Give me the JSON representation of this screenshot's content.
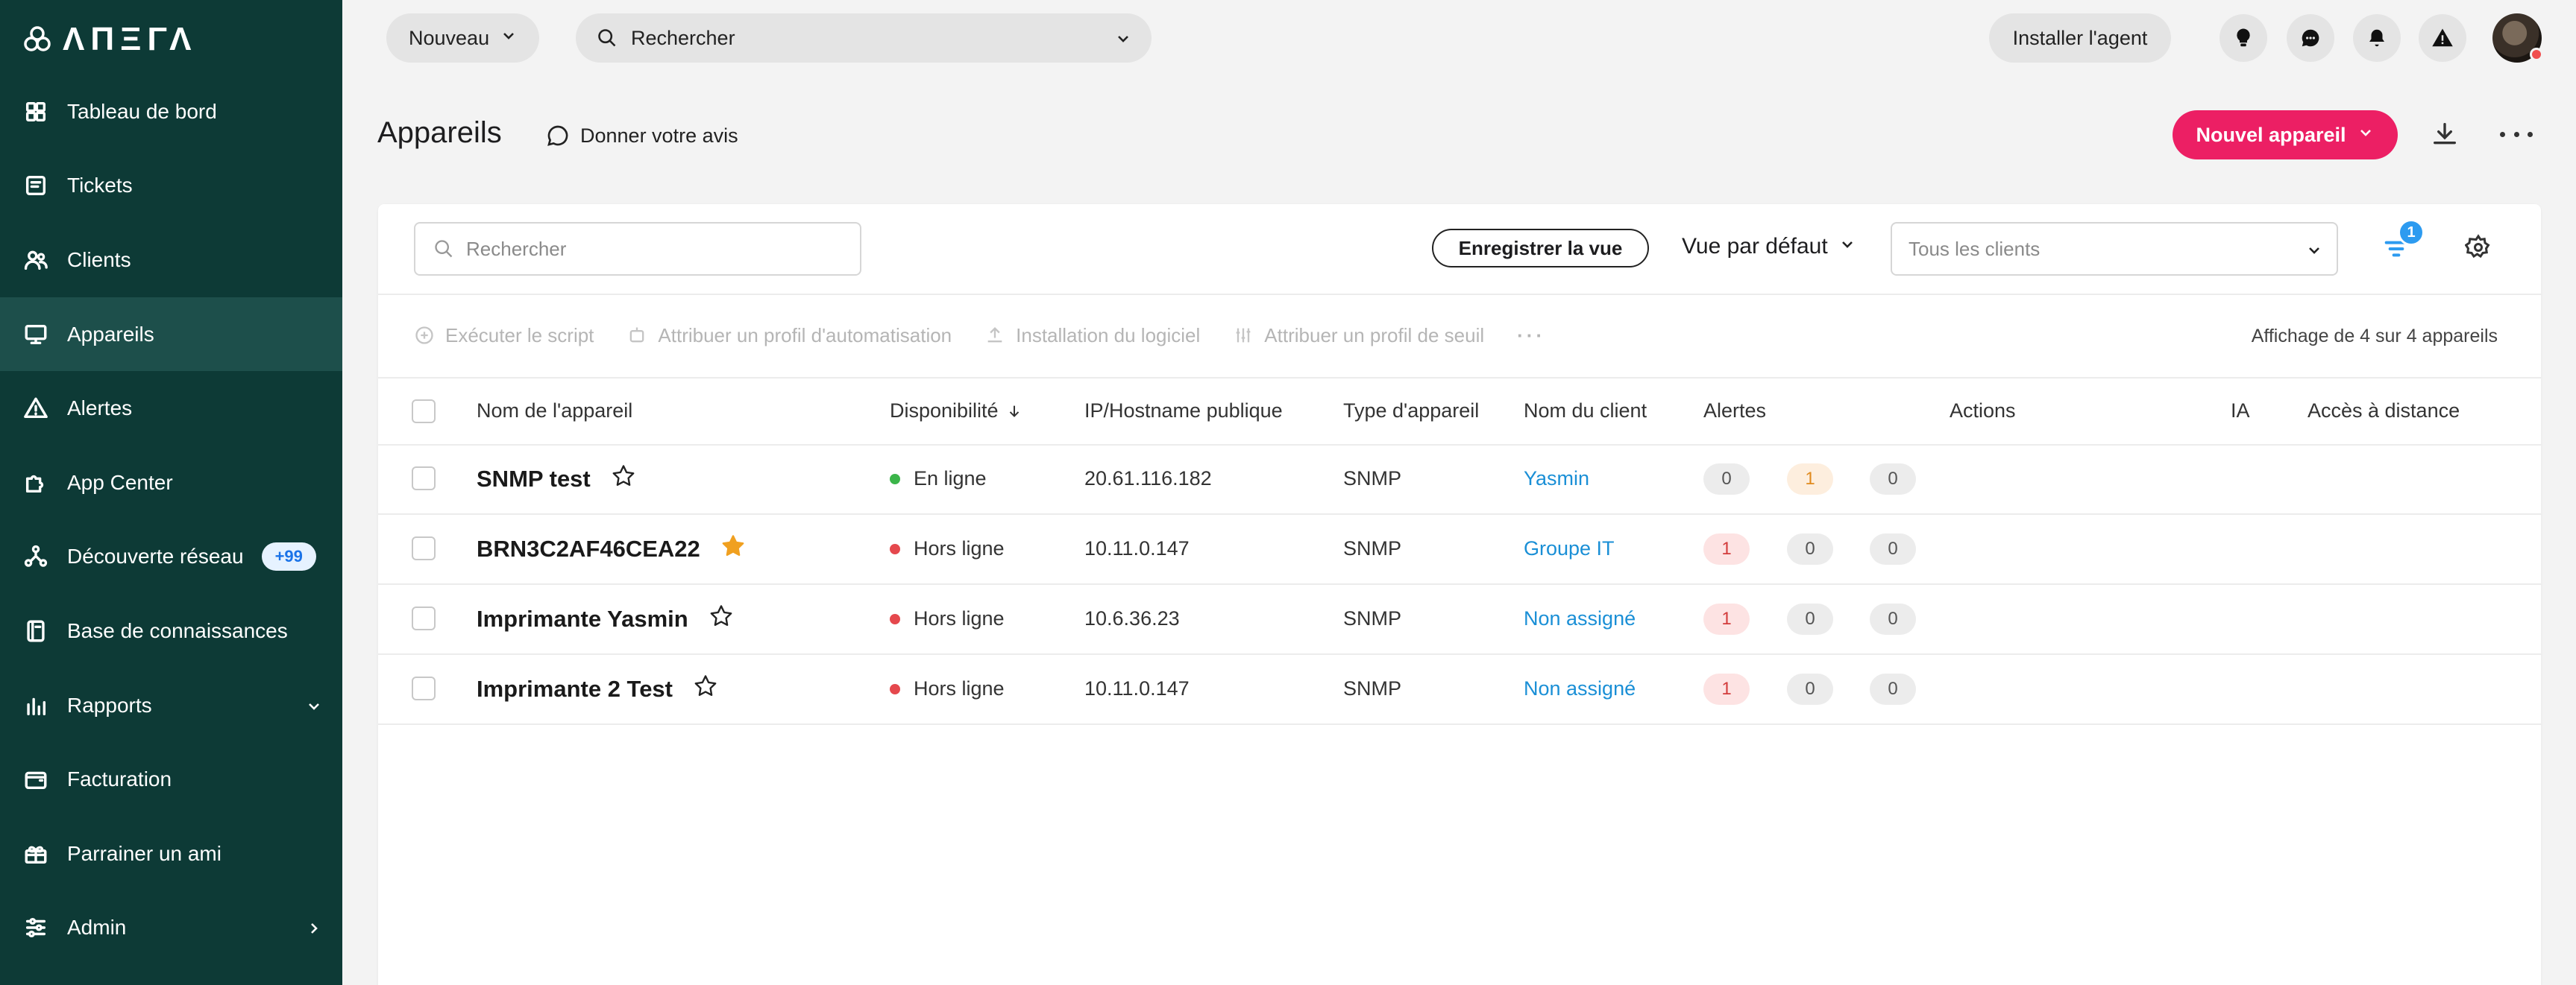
{
  "app": {
    "logo_text": "ΛΠΞΓΛ"
  },
  "sidebar": {
    "items": [
      {
        "label": "Tableau de bord",
        "icon": "dashboard-icon"
      },
      {
        "label": "Tickets",
        "icon": "ticket-icon"
      },
      {
        "label": "Clients",
        "icon": "users-icon"
      },
      {
        "label": "Appareils",
        "icon": "monitor-icon",
        "active": true
      },
      {
        "label": "Alertes",
        "icon": "warning-icon"
      },
      {
        "label": "App Center",
        "icon": "puzzle-icon"
      },
      {
        "label": "Découverte réseau",
        "icon": "network-icon",
        "badge": "+99"
      },
      {
        "label": "Base de connaissances",
        "icon": "book-icon"
      },
      {
        "label": "Rapports",
        "icon": "chart-icon",
        "arrow": "chevron-down-icon"
      },
      {
        "label": "Facturation",
        "icon": "wallet-icon"
      },
      {
        "label": "Parrainer un ami",
        "icon": "gift-icon"
      },
      {
        "label": "Admin",
        "icon": "sliders-icon",
        "arrow": "chevron-right-icon"
      }
    ]
  },
  "topbar": {
    "new_label": "Nouveau",
    "search_label": "Rechercher",
    "install_agent_label": "Installer l'agent"
  },
  "header": {
    "title": "Appareils",
    "feedback_label": "Donner votre avis",
    "new_device_label": "Nouvel appareil"
  },
  "filters": {
    "search_placeholder": "Rechercher",
    "save_view_label": "Enregistrer la vue",
    "view_label": "Vue par défaut",
    "clients_placeholder": "Tous les clients",
    "filter_count": "1"
  },
  "toolbar": {
    "run_script": "Exécuter le script",
    "assign_automation": "Attribuer un profil d'automatisation",
    "install_software": "Installation du logiciel",
    "assign_threshold": "Attribuer un profil de seuil",
    "showing": "Affichage de 4 sur 4 appareils"
  },
  "table": {
    "columns": {
      "name": "Nom de l'appareil",
      "availability": "Disponibilité",
      "ip": "IP/Hostname publique",
      "type": "Type d'appareil",
      "client": "Nom du client",
      "alerts": "Alertes",
      "actions": "Actions",
      "ai": "IA",
      "remote": "Accès à distance"
    },
    "rows": [
      {
        "name": "SNMP test",
        "favorite": false,
        "status": "En ligne",
        "status_color": "#3bb54a",
        "ip": "20.61.116.182",
        "type": "SNMP",
        "client": "Yasmin",
        "alerts": [
          "0",
          "1",
          "0"
        ]
      },
      {
        "name": "BRN3C2AF46CEA22",
        "favorite": true,
        "status": "Hors ligne",
        "status_color": "#e5484d",
        "ip": "10.11.0.147",
        "type": "SNMP",
        "client": "Groupe IT",
        "alerts": [
          "1",
          "0",
          "0"
        ]
      },
      {
        "name": "Imprimante Yasmin",
        "favorite": false,
        "status": "Hors ligne",
        "status_color": "#e5484d",
        "ip": "10.6.36.23",
        "type": "SNMP",
        "client": "Non assigné",
        "alerts": [
          "1",
          "0",
          "0"
        ]
      },
      {
        "name": "Imprimante 2 Test",
        "favorite": false,
        "status": "Hors ligne",
        "status_color": "#e5484d",
        "ip": "10.11.0.147",
        "type": "SNMP",
        "client": "Non assigné",
        "alerts": [
          "1",
          "0",
          "0"
        ]
      }
    ]
  },
  "colors": {
    "sidebar_bg": "#0d3a36",
    "accent": "#ec1f64",
    "link": "#1a8fd6",
    "star": "#f0a020"
  }
}
